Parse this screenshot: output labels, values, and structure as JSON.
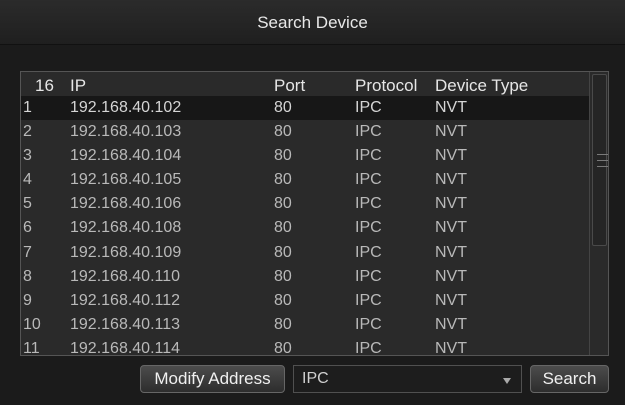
{
  "window": {
    "title": "Search Device"
  },
  "table": {
    "count": "16",
    "headers": {
      "ip": "IP",
      "port": "Port",
      "protocol": "Protocol",
      "device_type": "Device Type"
    },
    "rows": [
      {
        "index": "1",
        "ip": "192.168.40.102",
        "port": "80",
        "protocol": "IPC",
        "device_type": "NVT",
        "selected": true
      },
      {
        "index": "2",
        "ip": "192.168.40.103",
        "port": "80",
        "protocol": "IPC",
        "device_type": "NVT"
      },
      {
        "index": "3",
        "ip": "192.168.40.104",
        "port": "80",
        "protocol": "IPC",
        "device_type": "NVT"
      },
      {
        "index": "4",
        "ip": "192.168.40.105",
        "port": "80",
        "protocol": "IPC",
        "device_type": "NVT"
      },
      {
        "index": "5",
        "ip": "192.168.40.106",
        "port": "80",
        "protocol": "IPC",
        "device_type": "NVT"
      },
      {
        "index": "6",
        "ip": "192.168.40.108",
        "port": "80",
        "protocol": "IPC",
        "device_type": "NVT"
      },
      {
        "index": "7",
        "ip": "192.168.40.109",
        "port": "80",
        "protocol": "IPC",
        "device_type": "NVT"
      },
      {
        "index": "8",
        "ip": "192.168.40.110",
        "port": "80",
        "protocol": "IPC",
        "device_type": "NVT"
      },
      {
        "index": "9",
        "ip": "192.168.40.112",
        "port": "80",
        "protocol": "IPC",
        "device_type": "NVT"
      },
      {
        "index": "10",
        "ip": "192.168.40.113",
        "port": "80",
        "protocol": "IPC",
        "device_type": "NVT"
      },
      {
        "index": "11",
        "ip": "192.168.40.114",
        "port": "80",
        "protocol": "IPC",
        "device_type": "NVT"
      }
    ]
  },
  "footer": {
    "modify_label": "Modify Address",
    "protocol_select": {
      "value": "IPC"
    },
    "search_label": "Search"
  },
  "colors": {
    "background": "#1b1b1b",
    "panel": "#2a2a2a",
    "selected_row": "#171717",
    "text": "#b9b9b9"
  }
}
